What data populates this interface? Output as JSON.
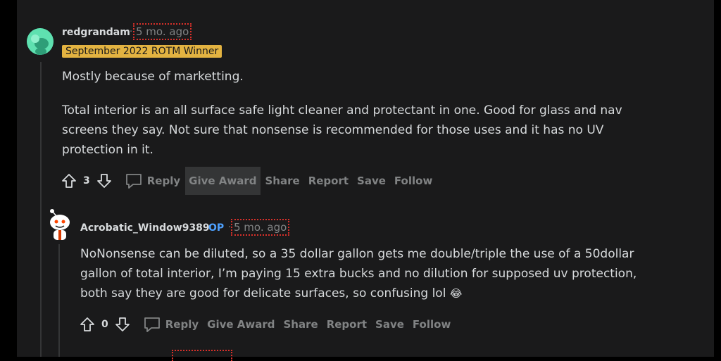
{
  "comment1": {
    "username": "redgrandam",
    "time": "5 mo. ago",
    "flair": "September 2022 ROTM Winner",
    "paragraph1": "Mostly because of marketting.",
    "paragraph2_line1": "Total interior is an all surface safe light cleaner and protectant in one. Good for glass and nav",
    "paragraph2_line2": "screens they say. Not sure that nonsense is recommended for those uses and it has no UV",
    "paragraph2_line3": "protection in it.",
    "votes": "3",
    "actions": {
      "reply": "Reply",
      "give_award": "Give Award",
      "share": "Share",
      "report": "Report",
      "save": "Save",
      "follow": "Follow"
    }
  },
  "comment2": {
    "username": "Acrobatic_Window9389",
    "op_badge": "OP",
    "time": "5 mo. ago",
    "line1": "NoNonsense can be diluted, so a 35 dollar gallon gets me double/triple the use of a 50dollar",
    "line2": "gallon of total interior, I’m paying 15 extra bucks and no dilution for supposed uv protection,",
    "line3": "both say they are good for delicate surfaces, so confusing lol",
    "emoji": "😂",
    "votes": "0",
    "actions": {
      "reply": "Reply",
      "give_award": "Give Award",
      "share": "Share",
      "report": "Report",
      "save": "Save",
      "follow": "Follow"
    }
  },
  "separator": "·",
  "colors": {
    "background": "#1a1a1b",
    "text": "#d7dadc",
    "muted": "#818384",
    "flair": "#e3b341",
    "op": "#4ea1ff",
    "highlight_outline": "#d9302a"
  }
}
